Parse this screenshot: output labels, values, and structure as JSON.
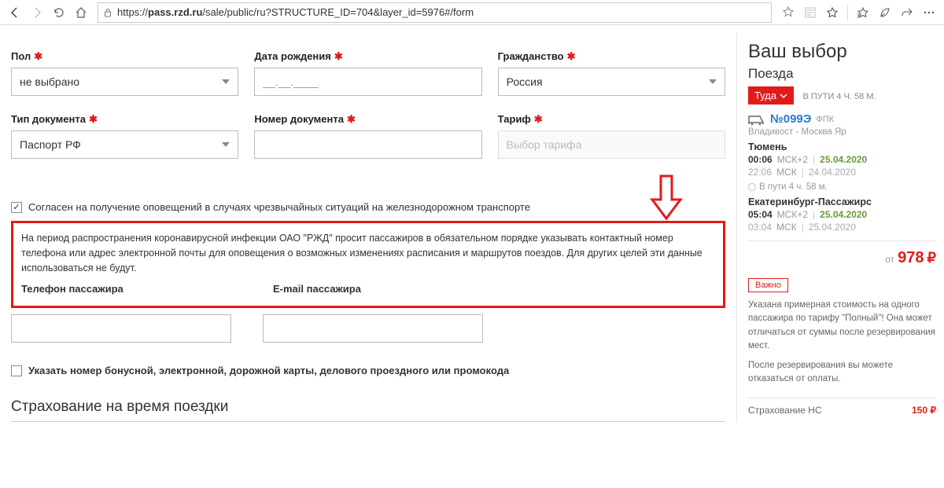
{
  "browser": {
    "url_host": "pass.rzd.ru",
    "url_path": "/sale/public/ru?STRUCTURE_ID=704&layer_id=5976#/form"
  },
  "form": {
    "gender": {
      "label": "Пол",
      "value": "не выбрано"
    },
    "birthdate": {
      "label": "Дата рождения",
      "placeholder": "__.__.____"
    },
    "citizenship": {
      "label": "Гражданство",
      "value": "Россия"
    },
    "doc_type": {
      "label": "Тип документа",
      "value": "Паспорт РФ"
    },
    "doc_number": {
      "label": "Номер документа"
    },
    "tariff": {
      "label": "Тариф",
      "placeholder": "Выбор тарифа"
    },
    "consent": "Согласен на получение оповещений в случаях чрезвычайных ситуаций на железнодорожном транспорте",
    "covid_notice": "На период распространения коронавирусной инфекции ОАО \"РЖД\" просит пассажиров в обязательном порядке указывать контактный номер телефона или адрес электронной почты для оповещения о возможных изменениях расписания и маршрутов поездов. Для других целей эти данные использоваться не будут.",
    "phone_label": "Телефон пассажира",
    "email_label": "E-mail пассажира",
    "bonus_label": "Указать номер бонусной, электронной, дорожной карты, делового проездного или промокода",
    "insurance_heading": "Страхование на время поездки"
  },
  "side": {
    "title": "Ваш выбор",
    "subtitle": "Поезда",
    "direction": "Туда",
    "duration_top": "В ПУТИ 4 Ч. 58 М.",
    "train_number": "№099Э",
    "train_company": "ФПК",
    "route": "Владивост - Москва Яр",
    "from_city": "Тюмень",
    "from_time": "00:06",
    "from_tz": "МСК+2",
    "from_date": "25.04.2020",
    "from_time2": "22:06",
    "from_tz2": "МСК",
    "from_date2": "24.04.2020",
    "travel": "В пути  4 ч. 58 м.",
    "to_city": "Екатеринбург-Пассажирс",
    "to_time": "05:04",
    "to_tz": "МСК+2",
    "to_date": "25.04.2020",
    "to_time2": "03:04",
    "to_tz2": "МСК",
    "to_date2": "25.04.2020",
    "price_from": "от",
    "price": "978",
    "currency": "₽",
    "important": "Важно",
    "important_text1": "Указана примерная стоимость на одного пассажира по тарифу \"Полный\"! Она может отличаться от суммы после резервирования мест.",
    "important_text2": "После резервирования вы можете отказаться от оплаты.",
    "ins_label": "Страхование НС",
    "ins_price": "150 ₽"
  }
}
